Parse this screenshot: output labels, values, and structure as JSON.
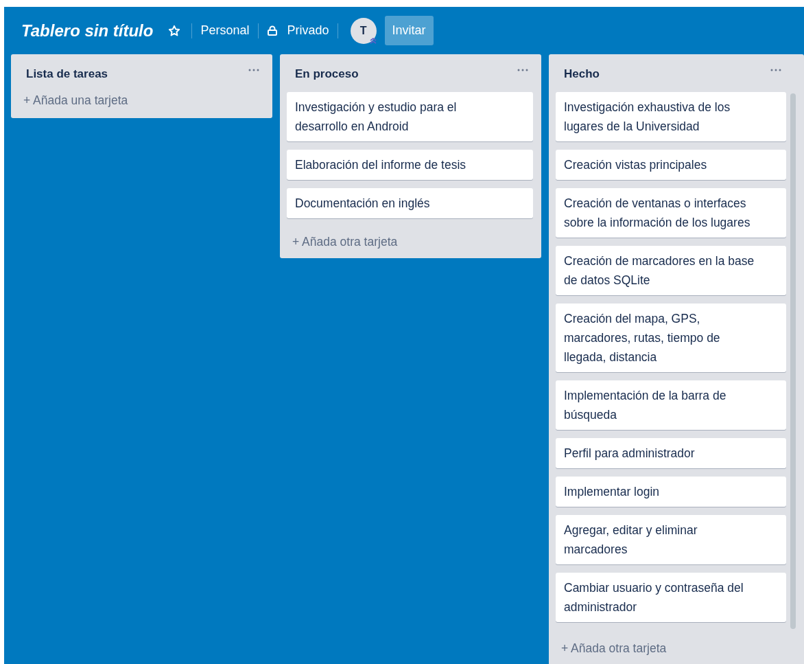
{
  "board": {
    "title": "Tablero sin título",
    "starred": false,
    "team": "Personal",
    "visibility": "Privado",
    "avatar": "T",
    "invite": "Invitar"
  },
  "lists": [
    {
      "title": "Lista de tareas",
      "add": "+ Añada una tarjeta"
    },
    {
      "title": "En proceso",
      "cards": [
        "Investigación y estudio para el desarrollo en Android",
        "Elaboración del informe de tesis",
        "Documentación en inglés"
      ],
      "add": "+ Añada otra tarjeta"
    },
    {
      "title": "Hecho",
      "cards": [
        "Investigación exhaustiva de los lugares de la Universidad",
        "Creación vistas principales",
        "Creación de ventanas o interfaces sobre la información de los lugares",
        "Creación de marcadores en la base de datos SQLite",
        "Creación del mapa, GPS, marcadores, rutas, tiempo de llegada, distancia",
        "Implementación de la barra de búsqueda",
        "Perfil para administrador",
        "Implementar login",
        "Agregar, editar y eliminar marcadores",
        "Cambiar usuario y contraseña del administrador"
      ],
      "add": "+ Añada otra tarjeta"
    }
  ]
}
